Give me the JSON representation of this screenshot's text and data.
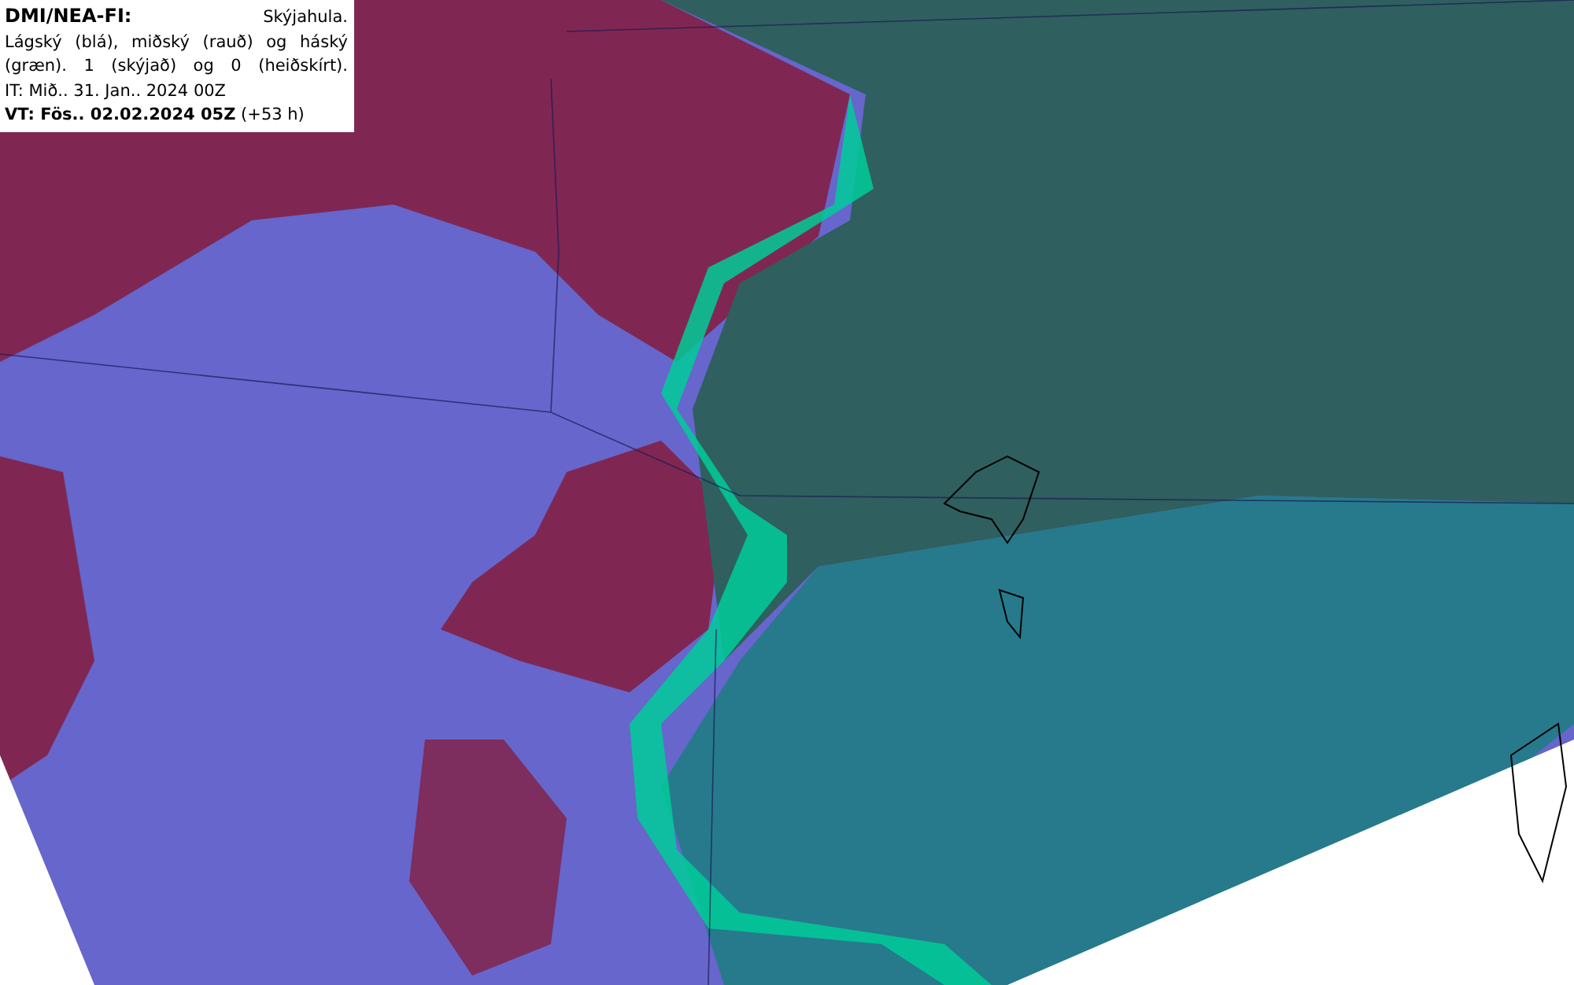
{
  "legend": {
    "source": "DMI/NEA-FI:",
    "title": "Skýjahula.",
    "description": "Lágský (blá), miðský (rauð) og háský (græn). 1 (skýjað) og 0 (heiðskírt).",
    "init_time": "IT: Mið.. 31. Jan.. 2024 00Z",
    "valid_time": "**VT: Fös.. 02.02.2024 05Z** (+53 h)"
  }
}
